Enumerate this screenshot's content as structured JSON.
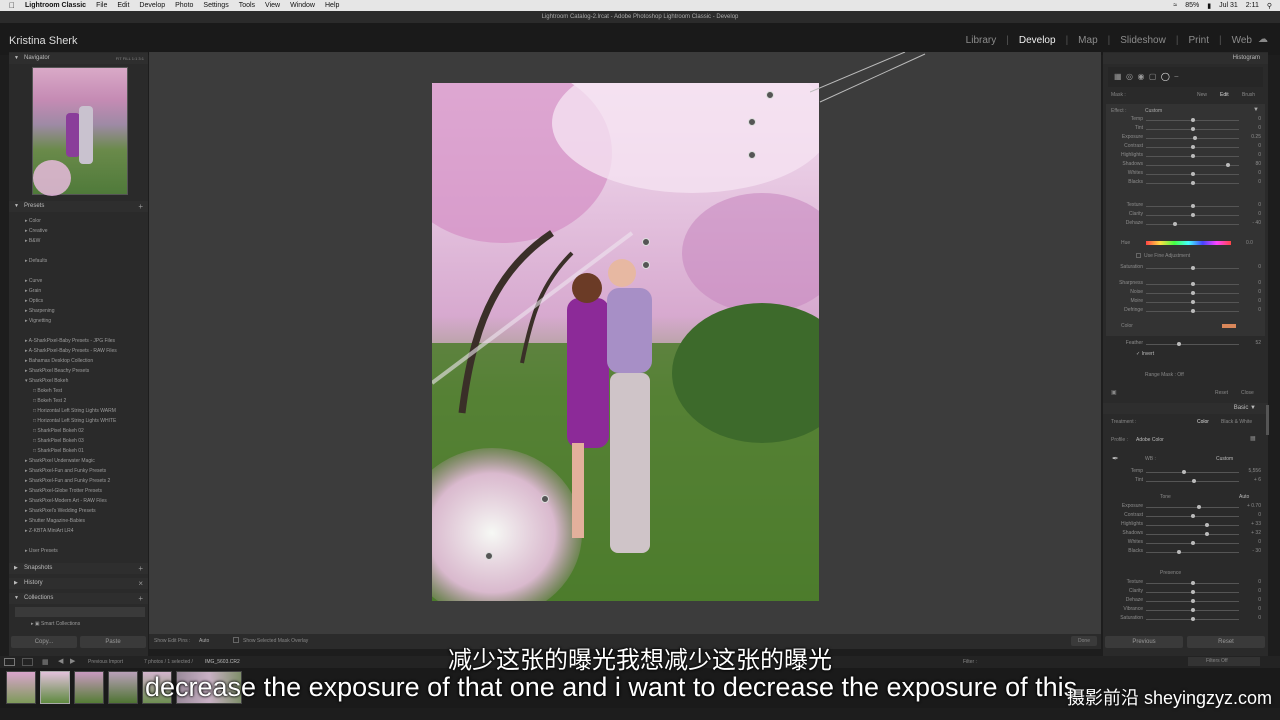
{
  "menubar": {
    "app_name": "Lightroom Classic",
    "menus": [
      "File",
      "Edit",
      "Develop",
      "Photo",
      "Settings",
      "Tools",
      "View",
      "Window",
      "Help"
    ],
    "battery": "85%",
    "date": "Jul 31",
    "time": "2:11"
  },
  "window_title": "Lightroom Catalog-2.lrcat - Adobe Photoshop Lightroom Classic - Develop",
  "identity": "Kristina Sherk",
  "modules": [
    "Library",
    "Develop",
    "Map",
    "Slideshow",
    "Print",
    "Web"
  ],
  "left": {
    "navigator": {
      "title": "Navigator",
      "zoom": "FIT  FILL  1:1  3:1"
    },
    "presets_title": "Presets",
    "groups_a": [
      "Color",
      "Creative",
      "B&W"
    ],
    "groups_b": [
      "Defaults"
    ],
    "groups_c": [
      "Curve",
      "Grain",
      "Optics",
      "Sharpening",
      "Vignetting"
    ],
    "groups_d": [
      "A-SharkPixel-Baby Presets - JPG Files",
      "A-SharkPixel-Baby Presets - RAW Files",
      "Bahamas Desktop Collection",
      "SharkPixel Beachy Presets",
      "SharkPixel Bokeh"
    ],
    "bokeh_items": [
      "Bokeh Test",
      "Bokeh Test 2",
      "Horizontal Left String Lights WARM",
      "Horizontal Left String Lights WHITE",
      "SharkPixel Bokeh 02",
      "SharkPixel Bokeh 03",
      "SharkPixel Bokeh 01"
    ],
    "groups_e": [
      "SharkPixel Underwater Magic",
      "SharkPixel-Fun and Funky Presets",
      "SharkPixel-Fun and Funky Presets 2",
      "SharkPixel-Globe Trotter Presets",
      "SharkPixel-Modern Art - RAW Files",
      "SharkPixel's Wedding Presets",
      "Shutter Magazine-Babies",
      "Z-KBTA MiniArt LR4"
    ],
    "user_presets": "User Presets",
    "snapshots": "Snapshots",
    "history": "History",
    "collections": "Collections",
    "smart_collections": "Smart Collections",
    "copy_btn": "Copy...",
    "paste_btn": "Paste"
  },
  "toolbar": {
    "show_edit_pins": "Show Edit Pins :",
    "auto": "Auto",
    "overlay": "Show Selected Mask Overlay",
    "done": "Done"
  },
  "right": {
    "histogram": "Histogram",
    "mask_label": "Mask :",
    "mask_new": "New",
    "mask_edit": "Edit",
    "mask_brush": "Brush",
    "effect_label": "Effect :",
    "effect_value": "Custom",
    "mask_sliders": [
      {
        "label": "Temp",
        "val": "0",
        "pos": 0.5
      },
      {
        "label": "Tint",
        "val": "0",
        "pos": 0.5
      },
      {
        "label": "Exposure",
        "val": "0.25",
        "pos": 0.53
      },
      {
        "label": "Contrast",
        "val": "0",
        "pos": 0.5
      },
      {
        "label": "Highlights",
        "val": "0",
        "pos": 0.5
      },
      {
        "label": "Shadows",
        "val": "80",
        "pos": 0.9
      },
      {
        "label": "Whites",
        "val": "0",
        "pos": 0.5
      },
      {
        "label": "Blacks",
        "val": "0",
        "pos": 0.5
      }
    ],
    "mask_sliders2": [
      {
        "label": "Texture",
        "val": "0",
        "pos": 0.5
      },
      {
        "label": "Clarity",
        "val": "0",
        "pos": 0.5
      },
      {
        "label": "Dehaze",
        "val": "- 40",
        "pos": 0.3
      }
    ],
    "hue_label": "Hue",
    "hue_val": "0.0",
    "fine_adjust": "Use Fine Adjustment",
    "saturation_label": "Saturation",
    "mask_sliders3": [
      {
        "label": "Sharpness",
        "val": "0",
        "pos": 0.5
      },
      {
        "label": "Noise",
        "val": "0",
        "pos": 0.5
      },
      {
        "label": "Moire",
        "val": "0",
        "pos": 0.5
      },
      {
        "label": "Defringe",
        "val": "0",
        "pos": 0.5
      }
    ],
    "color_label": "Color",
    "color_swatch": "#d9875a",
    "feather_label": "Feather",
    "feather_val": "52",
    "invert": "Invert",
    "range_mask": "Range Mask : Off",
    "reset": "Reset",
    "close": "Close",
    "basic": "Basic",
    "treatment_label": "Treatment :",
    "treatment_color": "Color",
    "treatment_bw": "Black & White",
    "profile_label": "Profile :",
    "profile_value": "Adobe Color",
    "wb_label": "WB :",
    "wb_value": "Custom",
    "basic_sliders": [
      {
        "label": "Temp",
        "val": "5,556",
        "pos": 0.4
      },
      {
        "label": "Tint",
        "val": "+ 6",
        "pos": 0.52
      }
    ],
    "tone_label": "Tone",
    "tone_auto": "Auto",
    "tone_sliders": [
      {
        "label": "Exposure",
        "val": "+ 0.70",
        "pos": 0.57
      },
      {
        "label": "Contrast",
        "val": "0",
        "pos": 0.5
      },
      {
        "label": "Highlights",
        "val": "+ 33",
        "pos": 0.66
      },
      {
        "label": "Shadows",
        "val": "+ 32",
        "pos": 0.66
      },
      {
        "label": "Whites",
        "val": "0",
        "pos": 0.5
      },
      {
        "label": "Blacks",
        "val": "- 30",
        "pos": 0.35
      }
    ],
    "presence_label": "Presence",
    "presence_sliders": [
      {
        "label": "Texture",
        "val": "0",
        "pos": 0.5
      },
      {
        "label": "Clarity",
        "val": "0",
        "pos": 0.5
      },
      {
        "label": "Dehaze",
        "val": "0",
        "pos": 0.5
      },
      {
        "label": "Vibrance",
        "val": "0",
        "pos": 0.5
      },
      {
        "label": "Saturation",
        "val": "0",
        "pos": 0.5
      }
    ],
    "previous": "Previous",
    "reset_btn": "Reset"
  },
  "filmstrip": {
    "source": "Previous Import",
    "count": "7 photos / 1 selected /",
    "file": "IMG_5603.CR2",
    "filter_label": "Filter :",
    "filters_off": "Filters Off"
  },
  "subtitles": {
    "chinese": "减少这张的曝光我想减少这张的曝光",
    "english": "decrease the exposure of that one and i want to decrease the exposure of this"
  },
  "watermark": "摄影前沿 sheyingzyz.com"
}
